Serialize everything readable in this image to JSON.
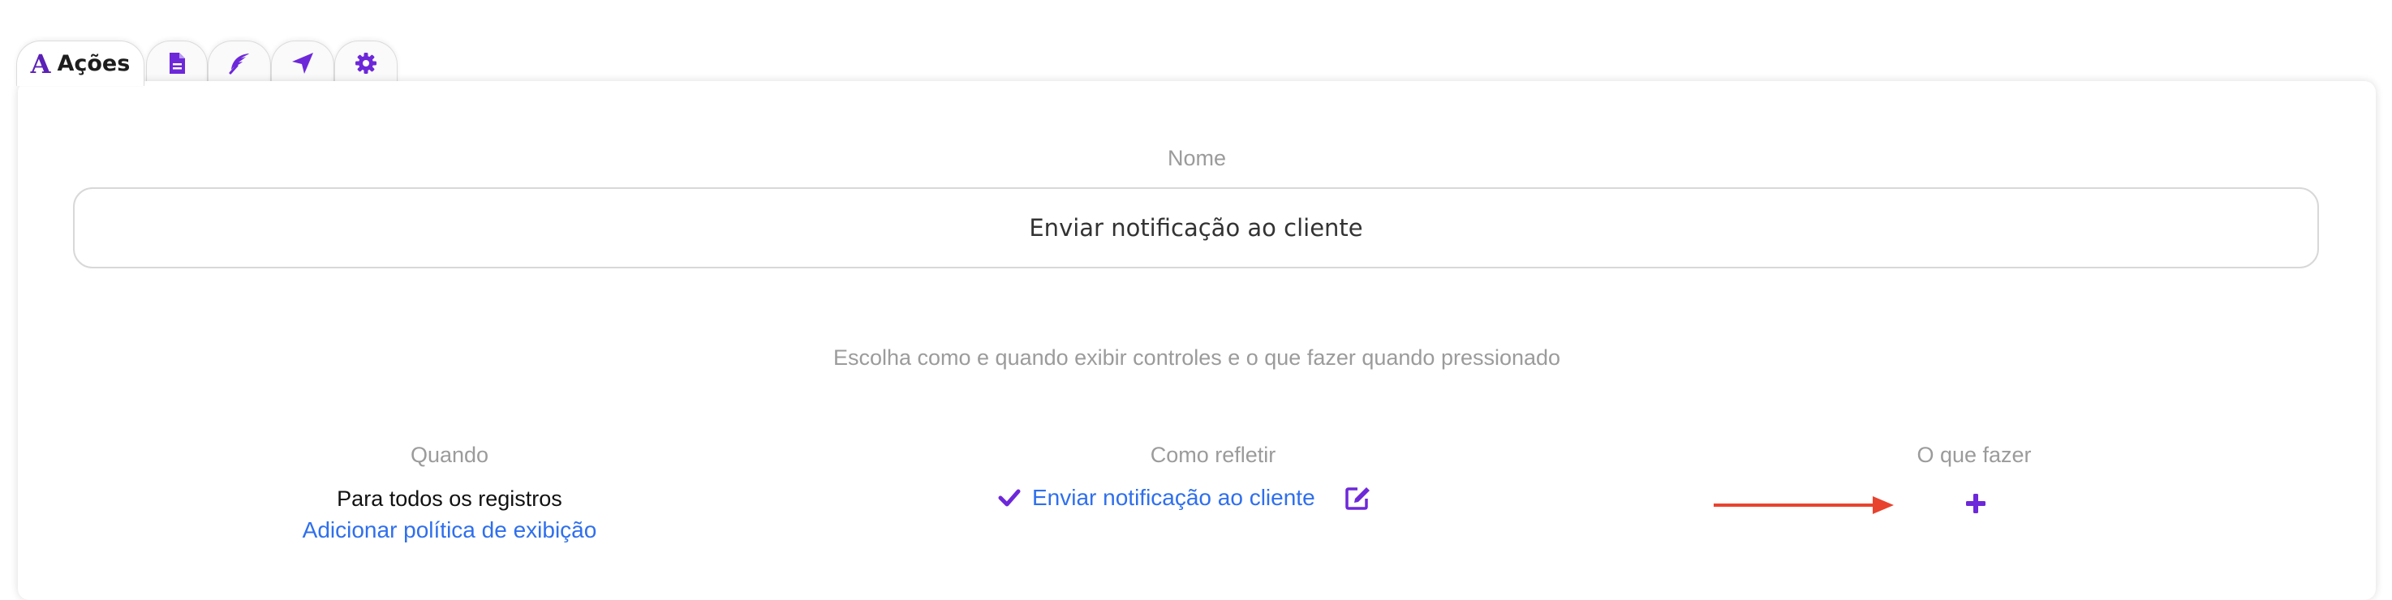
{
  "tabs": {
    "active_icon": "A",
    "active_label": "Ações",
    "others": [
      "document-icon",
      "feather-icon",
      "location-arrow-icon",
      "gear-icon"
    ]
  },
  "name_section": {
    "label": "Nome",
    "value": "Enviar notificação ao cliente"
  },
  "instructions": "Escolha como e quando exibir controles e o que fazer quando pressionado",
  "columns": {
    "when": {
      "header": "Quando",
      "text": "Para todos os registros",
      "link": "Adicionar política de exibição"
    },
    "reflect": {
      "header": "Como refletir",
      "link": "Enviar notificação ao cliente"
    },
    "action": {
      "header": "O que fazer"
    }
  },
  "colors": {
    "accent": "#6d28d9",
    "link": "#2f6fed",
    "arrow": "#e8432f"
  }
}
